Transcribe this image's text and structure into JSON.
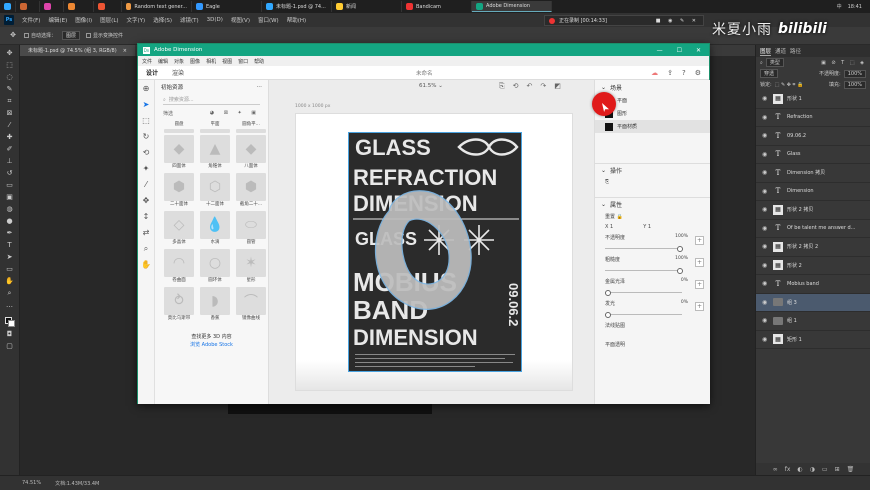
{
  "taskbar": {
    "tabs": [
      "Random text gener...",
      "Eagle",
      "未标题-1.psd @ 74...",
      "新闻",
      "Bandicam",
      "Adobe Dimension"
    ],
    "tray_time": "18:41",
    "tray_lang": "中"
  },
  "bandicam": {
    "status": "正在录制 [00:14:33]"
  },
  "watermark": {
    "name": "米夏小雨",
    "bili": "bilibili"
  },
  "ps": {
    "menu": [
      "文件(F)",
      "编辑(E)",
      "图像(I)",
      "图层(L)",
      "文字(Y)",
      "选择(S)",
      "滤镜(T)",
      "3D(D)",
      "视图(V)",
      "窗口(W)",
      "帮助(H)"
    ],
    "options": {
      "auto_select": "自动选择：",
      "group": "图层",
      "transform": "显示变换控件"
    },
    "doc_tab": "未标题-1.psd @ 74.5% (组 3, RGB/8)",
    "status": {
      "zoom": "74.51%",
      "doc": "文档:1.43M/33.4M"
    }
  },
  "layers_panel": {
    "tabs": [
      "图层",
      "通道",
      "路径"
    ],
    "kind": "类型",
    "blend": "穿透",
    "opacity_label": "不透明度:",
    "opacity": "100%",
    "lock_label": "锁定:",
    "fill_label": "填充:",
    "fill": "100%",
    "layers": [
      {
        "type": "shape",
        "name": "形状 1"
      },
      {
        "type": "text",
        "name": "Refraction"
      },
      {
        "type": "text",
        "name": "09.06.2"
      },
      {
        "type": "text",
        "name": "Glass"
      },
      {
        "type": "text",
        "name": "Dimension 拷贝"
      },
      {
        "type": "text",
        "name": "Dimension"
      },
      {
        "type": "shape",
        "name": "形状 2 拷贝"
      },
      {
        "type": "text",
        "name": "Of be talent me answer d..."
      },
      {
        "type": "shape",
        "name": "形状 2 拷贝 2"
      },
      {
        "type": "shape",
        "name": "形状 2"
      },
      {
        "type": "text",
        "name": "Mobius band"
      },
      {
        "type": "folder",
        "name": "组 3"
      },
      {
        "type": "folder",
        "name": "组 1"
      },
      {
        "type": "shape",
        "name": "矩形 1"
      }
    ]
  },
  "dimension": {
    "title": "Adobe Dimension",
    "menu": [
      "文件",
      "编辑",
      "对象",
      "图像",
      "相机",
      "视图",
      "窗口",
      "帮助"
    ],
    "modes": [
      "设计",
      "渲染"
    ],
    "doc_title": "未命名",
    "assets": {
      "header": "初始资源",
      "search_placeholder": "搜索资源...",
      "filter": "筛选",
      "items": [
        {
          "label": "圆盘"
        },
        {
          "label": "平面"
        },
        {
          "label": "圆角平..."
        },
        {
          "label": "四面体"
        },
        {
          "label": "角锥体"
        },
        {
          "label": "八面体"
        },
        {
          "label": "二十面体"
        },
        {
          "label": "十二面体"
        },
        {
          "label": "截角二十..."
        },
        {
          "label": "多晶体"
        },
        {
          "label": "水滴"
        },
        {
          "label": "圆管"
        },
        {
          "label": "卷曲面"
        },
        {
          "label": "圆环体"
        },
        {
          "label": "星形"
        },
        {
          "label": "莫比乌斯带"
        },
        {
          "label": "香蕉"
        },
        {
          "label": "镜像曲线"
        }
      ],
      "more": "查找更多 3D 内容",
      "stock": "浏览 Adobe Stock"
    },
    "canvas": {
      "zoom": "61.5%",
      "doc_size": "1000 x 1000 px"
    },
    "poster": {
      "lines": [
        "GLASS",
        "REFRACTION",
        "DIMENSION",
        "GLASS",
        "MOBIUS",
        "BAND",
        "DIMENSION"
      ],
      "date": "09.06.2"
    },
    "scene": {
      "header": "场景",
      "items": [
        {
          "name": "平面",
          "kind": "plane"
        },
        {
          "name": "图形",
          "kind": "shape"
        },
        {
          "name": "平面材质",
          "kind": "material"
        }
      ]
    },
    "actions": {
      "header": "操作"
    },
    "properties": {
      "header": "属性",
      "size": "重置",
      "x": "X  1",
      "y": "Y  1",
      "sliders": [
        {
          "label": "不透明度",
          "value": "100%",
          "pct": 1
        },
        {
          "label": "粗糙度",
          "value": "100%",
          "pct": 1
        },
        {
          "label": "金属光泽",
          "value": "0%",
          "pct": 0
        },
        {
          "label": "发光",
          "value": "0%",
          "pct": 0
        }
      ],
      "more": [
        "法线贴图",
        "平面透明"
      ]
    }
  }
}
